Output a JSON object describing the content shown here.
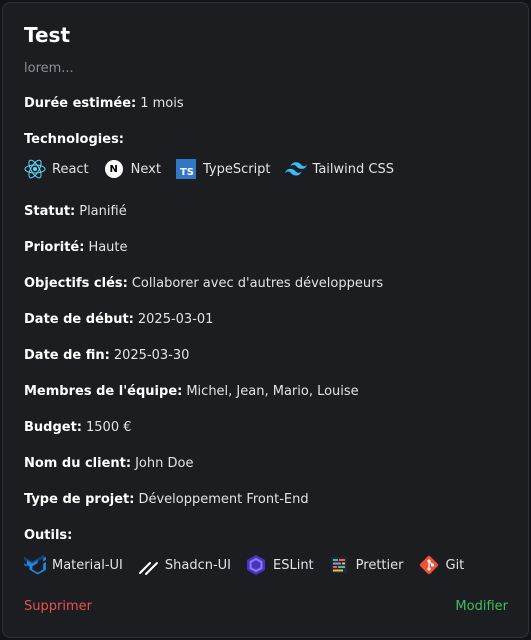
{
  "project": {
    "title": "Test",
    "description": "lorem...",
    "duration_label": "Durée estimée:",
    "duration_value": "1 mois",
    "technologies_label": "Technologies:",
    "technologies": [
      {
        "name": "React",
        "icon": "react-icon",
        "color": "#61dafb"
      },
      {
        "name": "Next",
        "icon": "nextjs-icon",
        "color": "#ffffff"
      },
      {
        "name": "TypeScript",
        "icon": "typescript-icon",
        "color": "#3178c6"
      },
      {
        "name": "Tailwind CSS",
        "icon": "tailwind-icon",
        "color": "#38bdf8"
      }
    ],
    "status_label": "Statut:",
    "status_value": "Planifié",
    "priority_label": "Priorité:",
    "priority_value": "Haute",
    "objectives_label": "Objectifs clés:",
    "objectives_value": "Collaborer avec d'autres développeurs",
    "start_label": "Date de début:",
    "start_value": "2025-03-01",
    "end_label": "Date de fin:",
    "end_value": "2025-03-30",
    "team_label": "Membres de l'équipe:",
    "team_value": "Michel, Jean, Mario, Louise",
    "budget_label": "Budget:",
    "budget_value": "1500 €",
    "client_label": "Nom du client:",
    "client_value": "John Doe",
    "type_label": "Type de projet:",
    "type_value": "Développement Front-End",
    "tools_label": "Outils:",
    "tools": [
      {
        "name": "Material-UI",
        "icon": "material-ui-icon",
        "color": "#1e88e5"
      },
      {
        "name": "Shadcn-UI",
        "icon": "shadcn-icon",
        "color": "#ffffff"
      },
      {
        "name": "ESLint",
        "icon": "eslint-icon",
        "color": "#6c5ce7"
      },
      {
        "name": "Prettier",
        "icon": "prettier-icon",
        "color": "#c596c7"
      },
      {
        "name": "Git",
        "icon": "git-icon",
        "color": "#f05033"
      }
    ]
  },
  "actions": {
    "delete_label": "Supprimer",
    "edit_label": "Modifier",
    "delete_color": "#e4524f",
    "edit_color": "#3fbf5c"
  }
}
